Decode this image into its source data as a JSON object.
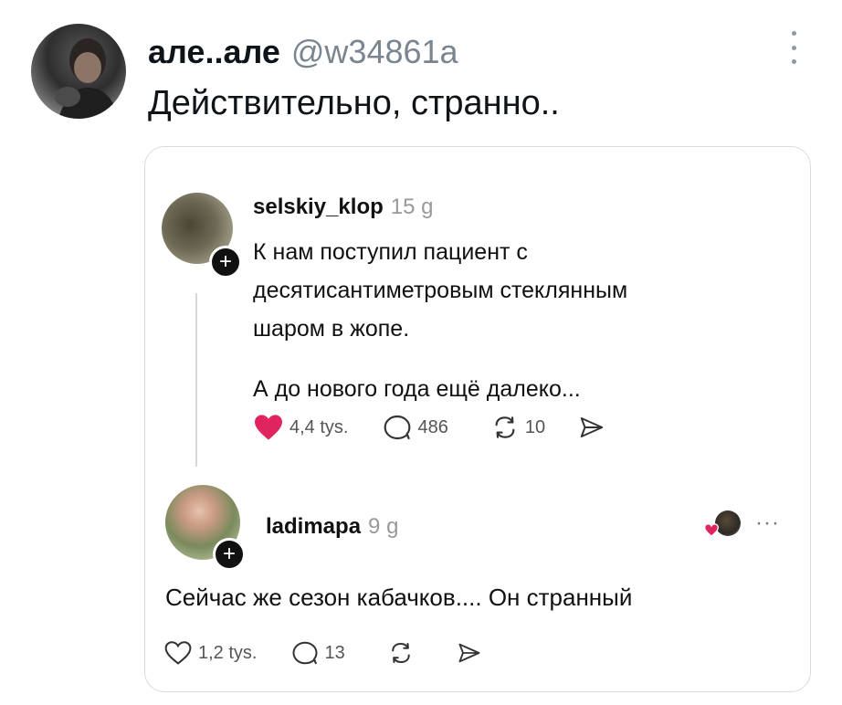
{
  "tweet": {
    "author_name": "але..але",
    "author_handle": "@w34861a",
    "text": "Действительно, странно.."
  },
  "quoted_post": {
    "username": "selskiy_klop",
    "time": "15 g",
    "paragraph1_lines": [
      "К нам поступил пациент с",
      "десятисантиметровым стеклянным",
      "шаром в жопе."
    ],
    "paragraph2": "А до нового года ещё далеко...",
    "likes": "4,4 tys.",
    "comments": "486",
    "reposts": "10",
    "like_color": "#e0245e"
  },
  "reply": {
    "username": "ladimapa",
    "time": "9 g",
    "text": "Сейчас же сезон кабачков.... Он странный",
    "likes": "1,2 tys.",
    "comments": "13",
    "more": "···"
  },
  "icons": {
    "plus_sign": "+"
  }
}
